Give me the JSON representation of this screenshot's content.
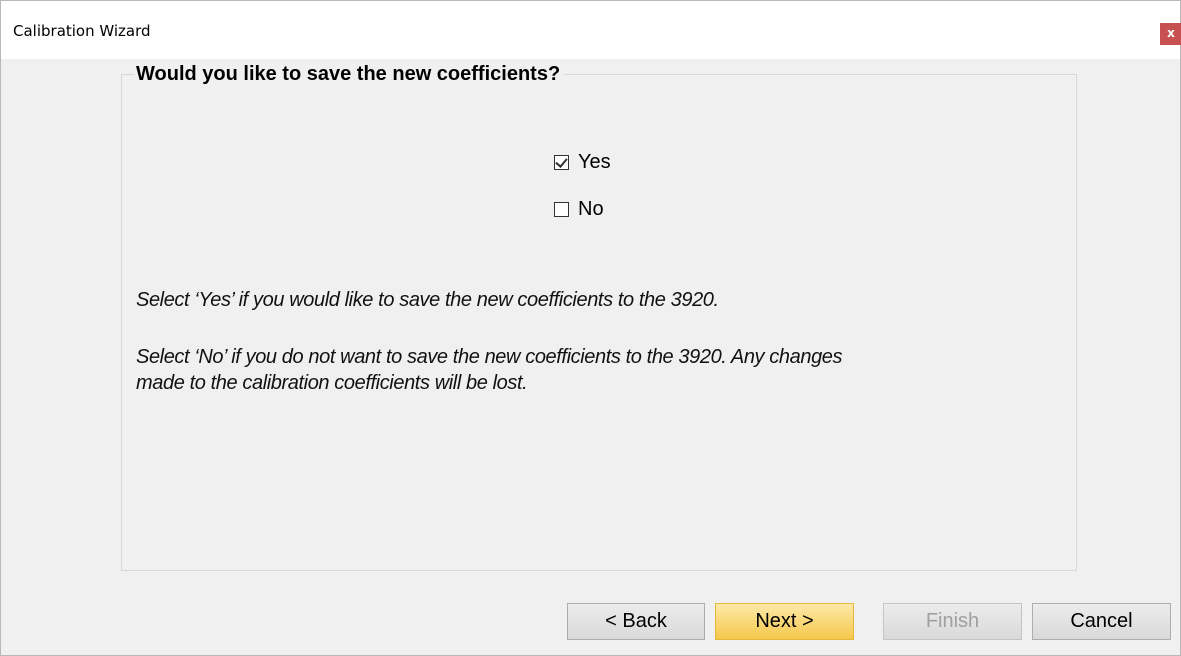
{
  "window": {
    "title": "Calibration Wizard",
    "close_label": "x"
  },
  "group": {
    "title": "Would you like to save the new coefficients?"
  },
  "options": [
    {
      "label": "Yes",
      "checked": true
    },
    {
      "label": "No",
      "checked": false
    }
  ],
  "description": {
    "line1": "Select ‘Yes’ if you would like to save the new coefficients to the 3920.",
    "line2": "Select ‘No’ if you do not want to save the new coefficients to the 3920.  Any changes",
    "line3": "made to the calibration coefficients will be lost."
  },
  "buttons": {
    "back": "< Back",
    "next": "Next >",
    "finish": "Finish",
    "cancel": "Cancel"
  },
  "colors": {
    "close_button": "#c75050",
    "next_button": "#f5c84c",
    "window_background": "#f0f0f0"
  }
}
